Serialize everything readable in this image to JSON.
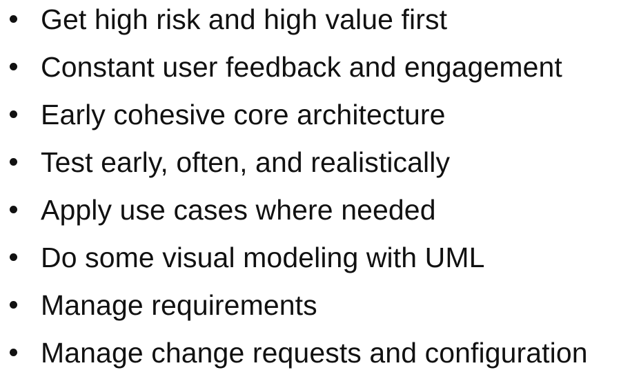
{
  "slide": {
    "bullets": [
      "Get high risk and high value first",
      "Constant user feedback and engagement",
      "Early cohesive core architecture",
      "Test early, often, and realistically",
      "Apply use cases where needed",
      "Do some visual modeling with UML",
      "Manage requirements",
      "Manage change requests and configuration"
    ]
  },
  "colors": {
    "text": "#111111",
    "background": "#ffffff"
  }
}
